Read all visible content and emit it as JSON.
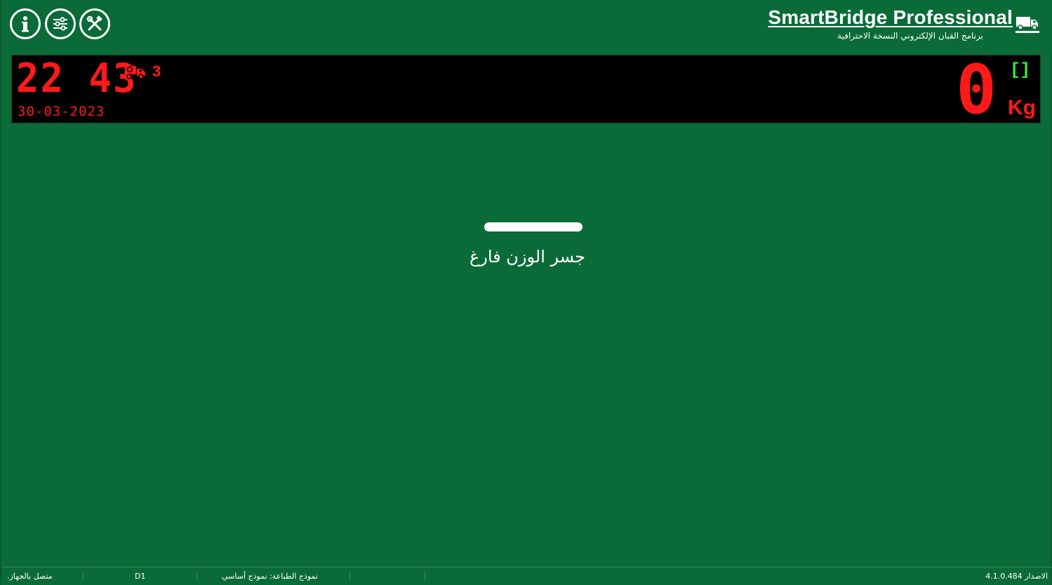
{
  "toolbar": {
    "info_icon": "info-icon",
    "settings_icon": "sliders-icon",
    "tools_icon": "tools-icon"
  },
  "brand": {
    "title": "SmartBridge Professional",
    "subtitle": "برنامج القبان الإلكتروني النسخة الاحترافية",
    "logo_icon": "truck-scale-icon"
  },
  "display": {
    "time": "22 43",
    "date": "30-03-2023",
    "truck_count": "3",
    "weight": "0",
    "unit": "Kg",
    "stable_indicator": "[]",
    "led_color": "#ff1a1a",
    "indicator_color": "#2bff2b"
  },
  "main": {
    "status_text": "جسر الوزن فارغ"
  },
  "statusbar": {
    "connection": ".متصل بالجهاز",
    "device": "D1",
    "print_template": "نموذج الطباعة: نموذج أساسي",
    "version": "الاصدار 4.1.0.484"
  },
  "colors": {
    "background": "#0b6b38",
    "text": "#ffffff"
  }
}
